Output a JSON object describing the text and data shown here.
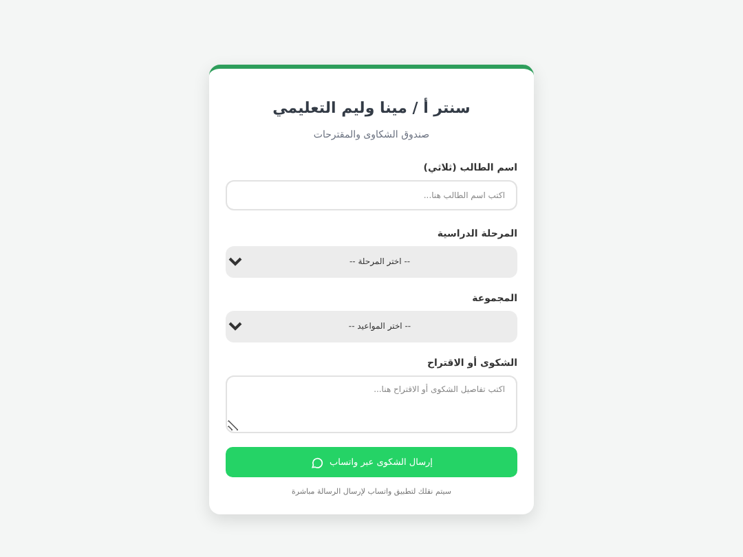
{
  "card": {
    "title": "سنتر أ / مينا وليم التعليمي",
    "subtitle": "صندوق الشكاوى والمقترحات"
  },
  "fields": [
    {
      "kind": "input",
      "label": "اسم الطالب (ثلاثي)",
      "placeholder": "اكتب اسم الطالب هنا..."
    },
    {
      "kind": "select",
      "label": "المرحلة الدراسية",
      "value": "-- اختر المرحلة --"
    },
    {
      "kind": "select",
      "label": "المجموعة",
      "value": "-- اختر المواعيد --"
    },
    {
      "kind": "textarea",
      "label": "الشكوى أو الاقتراح",
      "placeholder": "اكتب تفاصيل الشكوى أو الاقتراح هنا..."
    }
  ],
  "submit_button": "إرسال الشكوى عبر واتساب",
  "note": "سيتم نقلك لتطبيق واتساب لإرسال الرسالة مباشرة"
}
